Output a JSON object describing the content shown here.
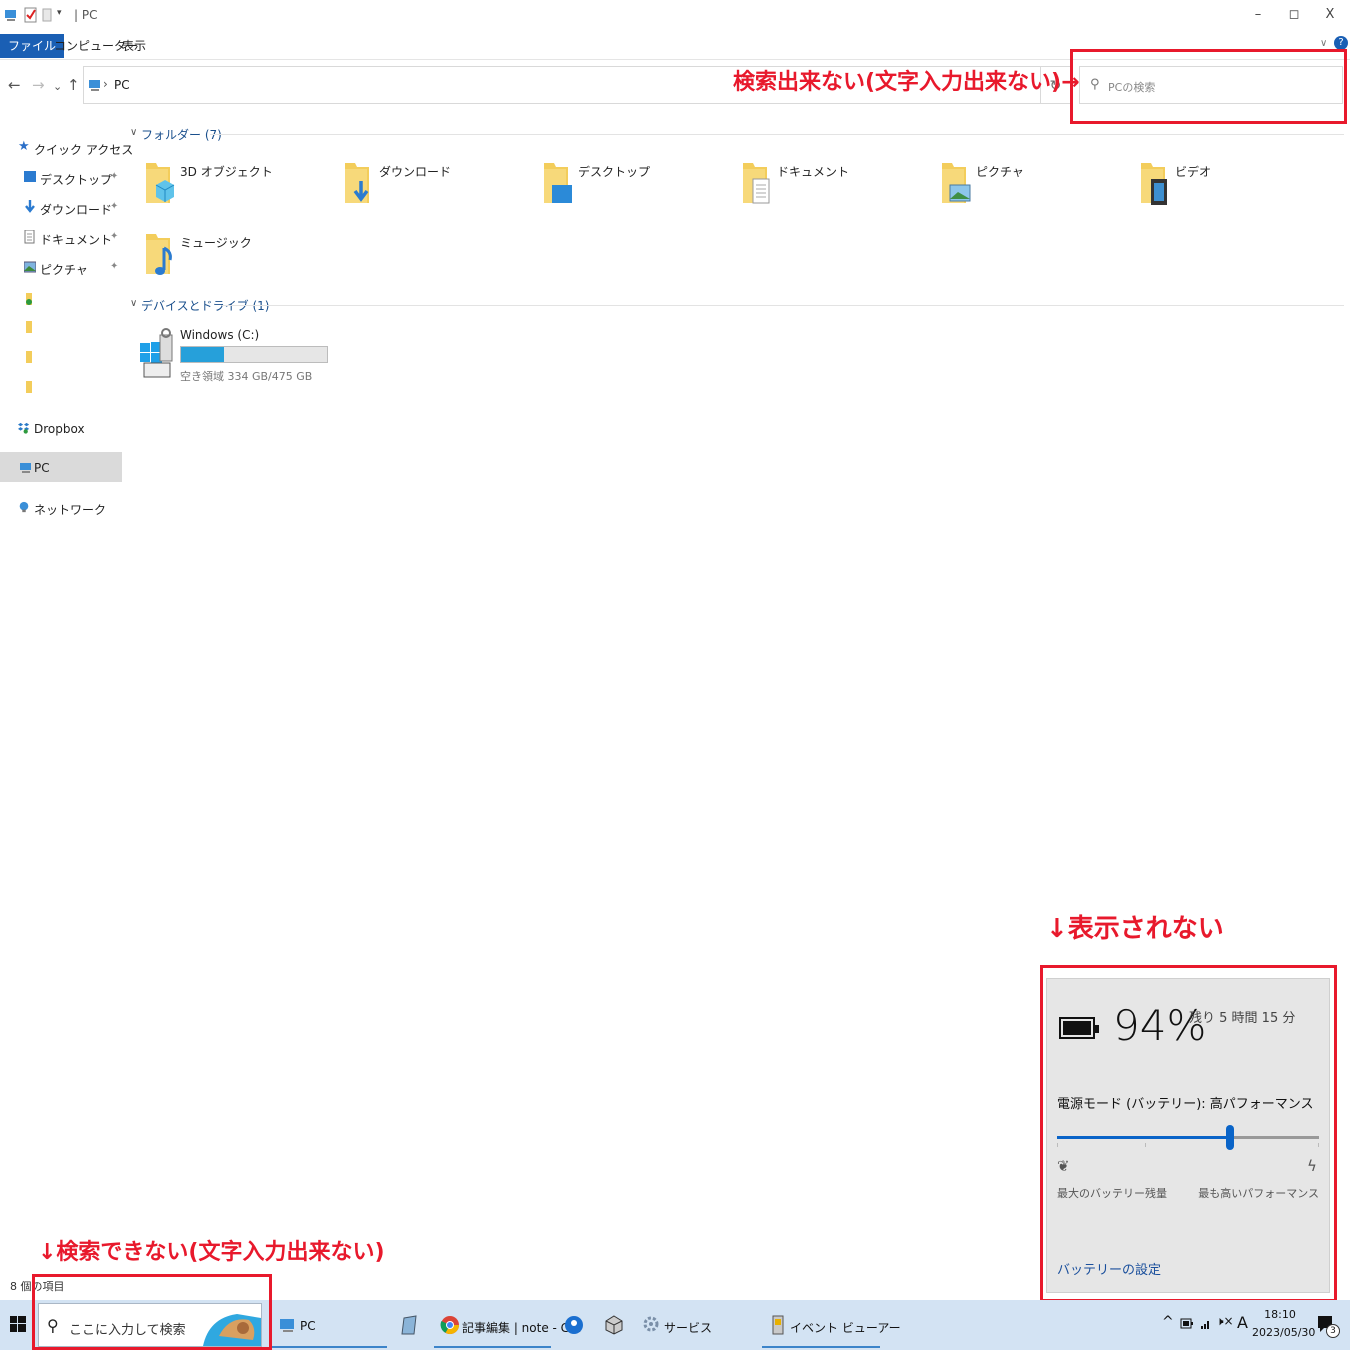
{
  "window": {
    "title": "PC",
    "controls": {
      "minimize": "–",
      "maximize": "◻",
      "close": "X"
    }
  },
  "ribbon": {
    "tabs": [
      "ファイル",
      "コンピューター",
      "表示"
    ],
    "help": "?"
  },
  "address": {
    "path": "PC",
    "separator": "›",
    "search_placeholder": "PCの検索",
    "back": "←",
    "forward": "→",
    "recent": "⌄",
    "up": "↑",
    "refresh": "↻"
  },
  "annotations": {
    "address_search": "検索出来ない(文字入力出来ない)→",
    "battery": "↓表示されない",
    "taskbar_search": "↓検索できない(文字入力出来ない)"
  },
  "nav": {
    "quick_access": "クイック アクセス",
    "pinned": [
      {
        "label": "デスクトップ",
        "icon": "desktop-icon"
      },
      {
        "label": "ダウンロード",
        "icon": "download-icon"
      },
      {
        "label": "ドキュメント",
        "icon": "document-icon"
      },
      {
        "label": "ピクチャ",
        "icon": "picture-icon"
      }
    ],
    "pin_glyph": "📌",
    "dropbox": "Dropbox",
    "pc": "PC",
    "network": "ネットワーク"
  },
  "content": {
    "folders_header": "フォルダー (7)",
    "folders": [
      {
        "label": "3D オブジェクト",
        "icon": "3d-objects-folder-icon"
      },
      {
        "label": "ダウンロード",
        "icon": "downloads-folder-icon"
      },
      {
        "label": "デスクトップ",
        "icon": "desktop-folder-icon"
      },
      {
        "label": "ドキュメント",
        "icon": "documents-folder-icon"
      },
      {
        "label": "ピクチャ",
        "icon": "pictures-folder-icon"
      },
      {
        "label": "ビデオ",
        "icon": "videos-folder-icon"
      },
      {
        "label": "ミュージック",
        "icon": "music-folder-icon"
      }
    ],
    "drives_header": "デバイスとドライブ (1)",
    "drive": {
      "label": "Windows (C:)",
      "space": "空き領域 334 GB/475 GB",
      "used_fraction": 0.297
    }
  },
  "status": {
    "items": "8 個の項目"
  },
  "battery": {
    "percent": "94%",
    "remaining": "残り 5 時間 15 分",
    "mode": "電源モード (バッテリー): 高パフォーマンス",
    "slider_value": 0.66,
    "left_label": "最大のバッテリー残量",
    "right_label": "最も高いパフォーマンス",
    "settings_link": "バッテリーの設定"
  },
  "taskbar": {
    "search_placeholder": "ここに入力して検索",
    "apps": [
      {
        "label": "PC"
      },
      {
        "label": ""
      },
      {
        "label": "記事編集 | note - G..."
      },
      {
        "label": ""
      },
      {
        "label": ""
      },
      {
        "label": "サービス"
      },
      {
        "label": "イベント ビューアー"
      }
    ],
    "tray": {
      "chevron": "^",
      "ime": "A",
      "volume": "🕨×"
    },
    "time": "18:10",
    "date": "2023/05/30",
    "notification_count": "3"
  },
  "colors": {
    "annotation": "#e8192c",
    "accent": "#1a5fb4",
    "drive_fill": "#26a0da",
    "slider": "#0a64c8",
    "taskbar": "#d3e3f3"
  }
}
